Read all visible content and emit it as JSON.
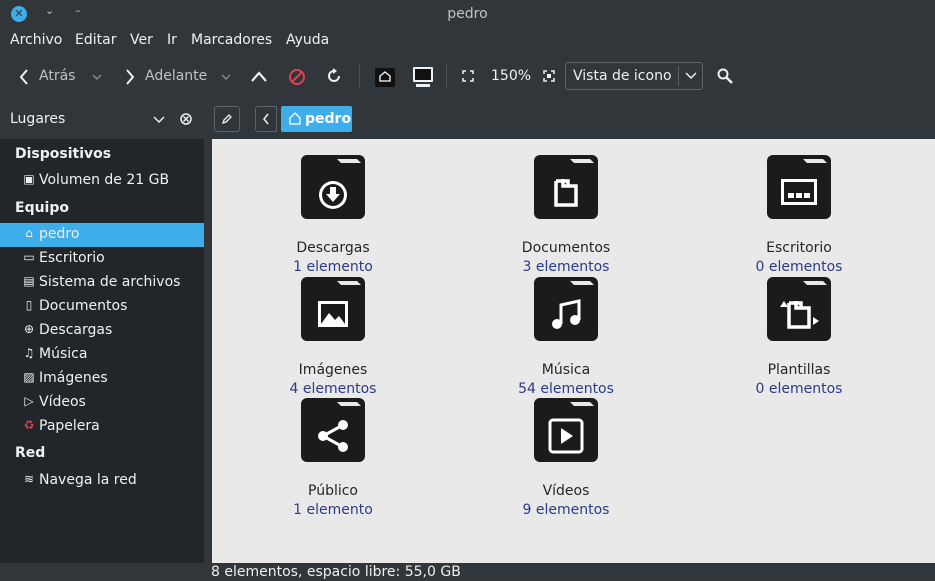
{
  "window": {
    "title": "pedro",
    "close_glyph": "✕",
    "minimize_glyph": "–",
    "restore_glyph": "⌄"
  },
  "menubar": {
    "items": [
      "Archivo",
      "Editar",
      "Ver",
      "Ir",
      "Marcadores",
      "Ayuda"
    ]
  },
  "toolbar": {
    "back_label": "Atrás",
    "forward_label": "Adelante",
    "zoom_level": "150%",
    "view_mode": "Vista de icono"
  },
  "sidebar": {
    "header_label": "Lugares",
    "sections": [
      {
        "title": "Dispositivos",
        "items": [
          {
            "label": "Volumen de 21 GB",
            "icon": "drive-icon"
          }
        ]
      },
      {
        "title": "Equipo",
        "items": [
          {
            "label": "pedro",
            "icon": "home-icon",
            "selected": true
          },
          {
            "label": "Escritorio",
            "icon": "desktop-icon"
          },
          {
            "label": "Sistema de archivos",
            "icon": "filesystem-icon"
          },
          {
            "label": "Documentos",
            "icon": "documents-icon"
          },
          {
            "label": "Descargas",
            "icon": "downloads-icon"
          },
          {
            "label": "Música",
            "icon": "music-icon"
          },
          {
            "label": "Imágenes",
            "icon": "pictures-icon"
          },
          {
            "label": "Vídeos",
            "icon": "videos-icon"
          },
          {
            "label": "Papelera",
            "icon": "trash-icon"
          }
        ]
      },
      {
        "title": "Red",
        "items": [
          {
            "label": "Navega la red",
            "icon": "network-icon"
          }
        ]
      }
    ]
  },
  "location": {
    "current": "pedro"
  },
  "folders": [
    {
      "name": "Descargas",
      "count": "1 elemento",
      "icon": "downloads-folder-icon"
    },
    {
      "name": "Documentos",
      "count": "3 elementos",
      "icon": "documents-folder-icon"
    },
    {
      "name": "Escritorio",
      "count": "0 elementos",
      "icon": "desktop-folder-icon"
    },
    {
      "name": "Imágenes",
      "count": "4 elementos",
      "icon": "pictures-folder-icon"
    },
    {
      "name": "Música",
      "count": "54 elementos",
      "icon": "music-folder-icon"
    },
    {
      "name": "Plantillas",
      "count": "0 elementos",
      "icon": "templates-folder-icon"
    },
    {
      "name": "Público",
      "count": "1 elemento",
      "icon": "public-folder-icon"
    },
    {
      "name": "Vídeos",
      "count": "9 elementos",
      "icon": "videos-folder-icon"
    }
  ],
  "status": {
    "text": "8 elementos, espacio libre: 55,0 GB"
  },
  "colors": {
    "accent": "#3daee9",
    "window_bg": "#31363b",
    "sidebar_bg": "#232629",
    "content_bg": "#e9e9e9",
    "count_text": "#2c3a8a"
  }
}
